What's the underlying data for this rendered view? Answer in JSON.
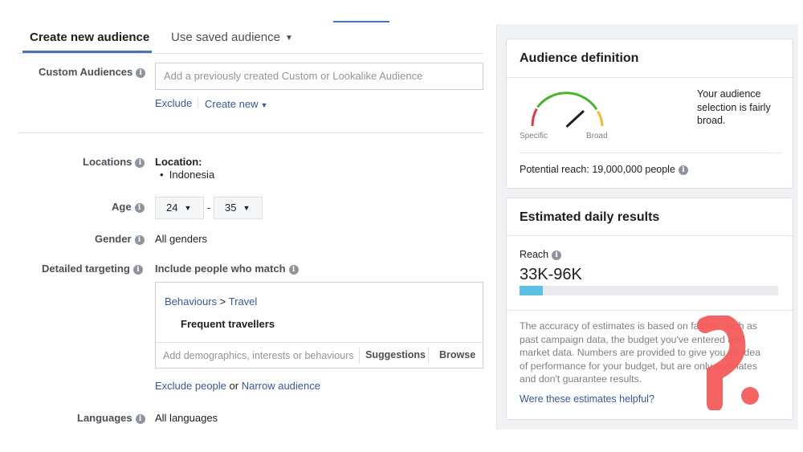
{
  "tabs": {
    "create_new": "Create new audience",
    "use_saved": "Use saved audience"
  },
  "custom_audiences": {
    "label": "Custom Audiences",
    "placeholder": "Add a previously created Custom or Lookalike Audience",
    "exclude": "Exclude",
    "create_new": "Create new"
  },
  "locations": {
    "label": "Locations",
    "heading": "Location:",
    "items": [
      "Indonesia"
    ]
  },
  "age": {
    "label": "Age",
    "min": "24",
    "max": "35",
    "separator": "-"
  },
  "gender": {
    "label": "Gender",
    "value": "All genders"
  },
  "detailed_targeting": {
    "label": "Detailed targeting",
    "include_text": "Include people who match",
    "category": "Behaviours",
    "breadcrumb_sep": ">",
    "subcategory": "Travel",
    "selected": "Frequent travellers",
    "input_placeholder": "Add demographics, interests or behaviours",
    "suggestions": "Suggestions",
    "browse": "Browse",
    "exclude_people": "Exclude people",
    "or": "or",
    "narrow": "Narrow audience"
  },
  "languages": {
    "label": "Languages",
    "value": "All languages"
  },
  "audience_definition": {
    "title": "Audience definition",
    "specific": "Specific",
    "broad": "Broad",
    "message": [
      "Your audience",
      "selection is fairly",
      "broad."
    ],
    "potential_reach": "Potential reach: 19,000,000 people",
    "gauge_level": 0.65
  },
  "daily_results": {
    "title": "Estimated daily results",
    "reach_label": "Reach",
    "reach_value": "33K-96K",
    "reach_fill": 0.09,
    "disclaimer": [
      "The accuracy of estimates is based on factors such as",
      "past campaign data, the budget you've entered and",
      "market data. Numbers are provided to give you an idea",
      "of performance for your budget, but are only estimates",
      "and don't guarantee results."
    ],
    "helpful_link": "Were these estimates helpful?"
  },
  "colors": {
    "link": "#365899",
    "tab_accent": "#4a73b8",
    "gauge_green": "#42b72a",
    "gauge_orange": "#f7b928",
    "gauge_red": "#e0393e",
    "reach_fill": "#5bc0e3",
    "watermark": "#f45b5b"
  }
}
